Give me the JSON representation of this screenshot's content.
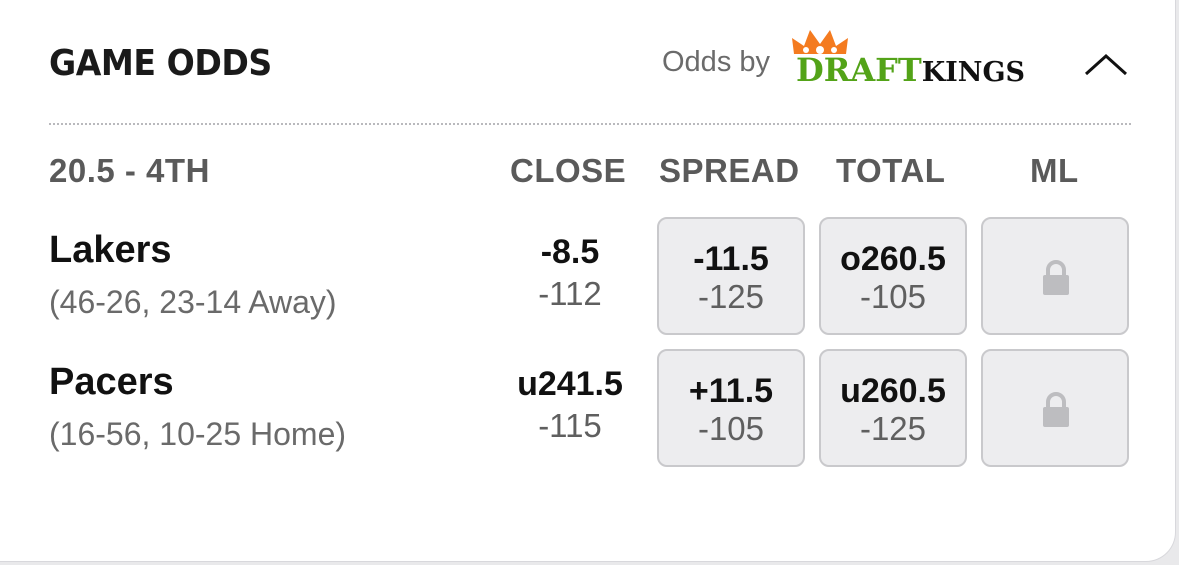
{
  "header": {
    "title": "GAME ODDS",
    "odds_by": "Odds by",
    "provider_logo": {
      "part1": "DRAFT",
      "part2": "KINGS"
    },
    "collapse_icon": "chevron-up-icon"
  },
  "game": {
    "status": "20.5 - 4TH",
    "columns": [
      "CLOSE",
      "SPREAD",
      "TOTAL",
      "ML"
    ]
  },
  "teams": [
    {
      "name": "Lakers",
      "record": "(46-26, 23-14 Away)",
      "close": {
        "line": "-8.5",
        "price": "-112"
      },
      "spread": {
        "line": "-11.5",
        "price": "-125"
      },
      "total": {
        "line": "o260.5",
        "price": "-105"
      },
      "ml": {
        "locked": true,
        "icon": "lock-icon"
      }
    },
    {
      "name": "Pacers",
      "record": "(16-56, 10-25 Home)",
      "close": {
        "line": "u241.5",
        "price": "-115"
      },
      "spread": {
        "line": "+11.5",
        "price": "-105"
      },
      "total": {
        "line": "u260.5",
        "price": "-125"
      },
      "ml": {
        "locked": true,
        "icon": "lock-icon"
      }
    }
  ],
  "colors": {
    "draftkings_green": "#53a318",
    "draftkings_orange": "#f47b20",
    "box_background": "#ededef"
  }
}
